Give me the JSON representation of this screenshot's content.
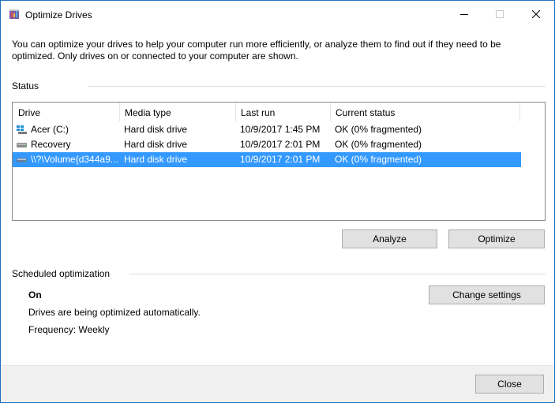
{
  "window": {
    "title": "Optimize Drives",
    "icon": "optimize-drives-icon"
  },
  "description": "You can optimize your drives to help your computer run more efficiently, or analyze them to find out if they need to be optimized. Only drives on or connected to your computer are shown.",
  "status": {
    "label": "Status",
    "columns": [
      "Drive",
      "Media type",
      "Last run",
      "Current status"
    ],
    "rows": [
      {
        "drive": "Acer (C:)",
        "icon": "windows-drive-icon",
        "media_type": "Hard disk drive",
        "last_run": "10/9/2017 1:45 PM",
        "current_status": "OK (0% fragmented)",
        "selected": false
      },
      {
        "drive": "Recovery",
        "icon": "hard-drive-icon",
        "media_type": "Hard disk drive",
        "last_run": "10/9/2017 2:01 PM",
        "current_status": "OK (0% fragmented)",
        "selected": false
      },
      {
        "drive": "\\\\?\\Volume{d344a9...",
        "icon": "hard-drive-icon",
        "media_type": "Hard disk drive",
        "last_run": "10/9/2017 2:01 PM",
        "current_status": "OK (0% fragmented)",
        "selected": true
      }
    ],
    "analyze_label": "Analyze",
    "optimize_label": "Optimize"
  },
  "scheduled": {
    "label": "Scheduled optimization",
    "state": "On",
    "line1": "Drives are being optimized automatically.",
    "line2": "Frequency: Weekly",
    "change_label": "Change settings"
  },
  "footer": {
    "close_label": "Close"
  },
  "colors": {
    "selection": "#3399ff",
    "border": "#1f6fbf"
  }
}
